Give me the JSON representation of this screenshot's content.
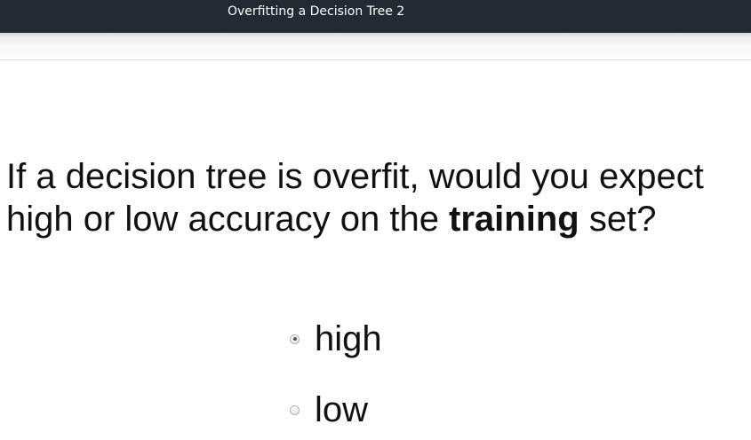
{
  "header": {
    "title": "Overfitting a Decision Tree 2"
  },
  "question": {
    "text_before": "If a decision tree is overfit, would you expect high or low accuracy on the ",
    "emphasis": "training",
    "text_after": " set?"
  },
  "options": [
    {
      "label": "high",
      "selected": true
    },
    {
      "label": "low",
      "selected": false
    }
  ],
  "colors": {
    "title_bar": "#222b33",
    "title_text": "#ffffff",
    "body_text": "#111111"
  }
}
